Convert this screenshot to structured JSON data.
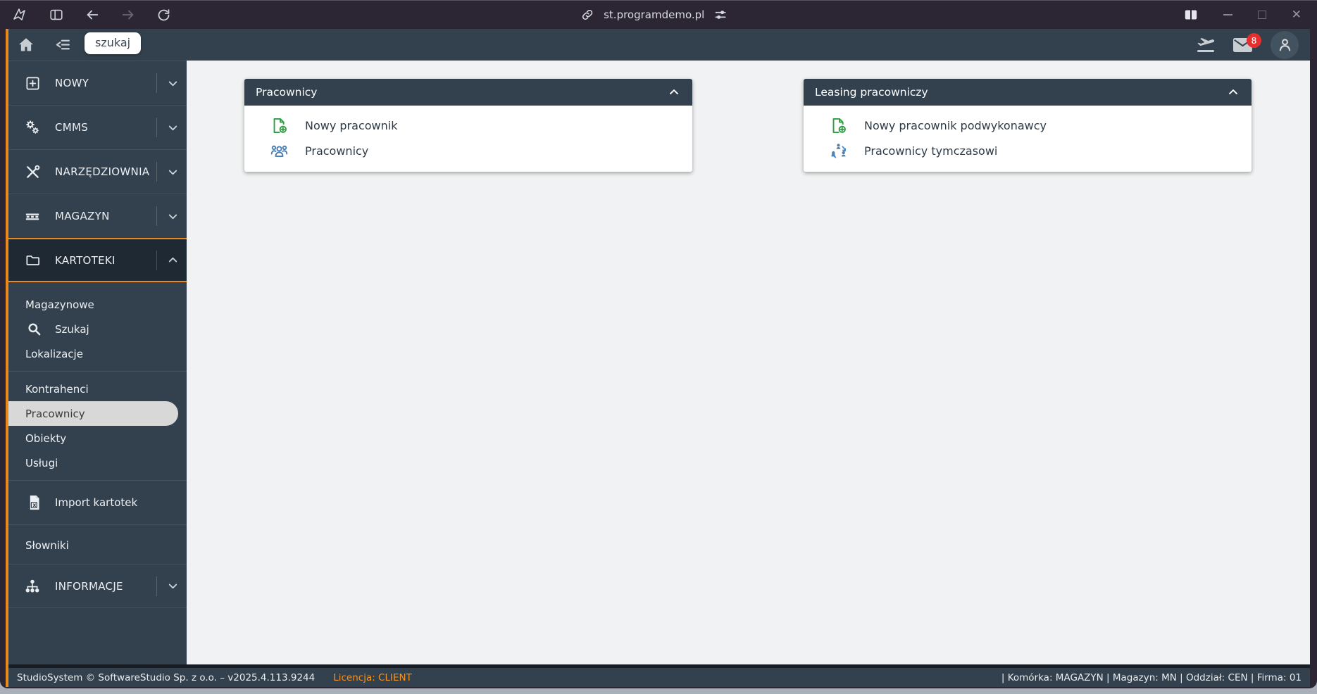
{
  "browser": {
    "url": "st.programdemo.pl"
  },
  "toolbar": {
    "tooltip": "szukaj",
    "mail_badge": "8"
  },
  "sidebar": {
    "categories": [
      {
        "label": "NOWY"
      },
      {
        "label": "CMMS"
      },
      {
        "label": "NARZĘDZIOWNIA"
      },
      {
        "label": "MAGAZYN"
      },
      {
        "label": "KARTOTEKI",
        "expanded": true
      },
      {
        "label": "INFORMACJE"
      }
    ],
    "kartoteki_items": [
      {
        "label": "Magazynowe"
      },
      {
        "label": "Szukaj",
        "icon": "search-icon"
      },
      {
        "label": "Lokalizacje"
      },
      {
        "label": "Kontrahenci"
      },
      {
        "label": "Pracownicy",
        "selected": true
      },
      {
        "label": "Obiekty"
      },
      {
        "label": "Usługi"
      },
      {
        "label": "Import kartotek",
        "icon": "file-excel-icon"
      },
      {
        "label": "Słowniki"
      }
    ]
  },
  "panels": [
    {
      "title": "Pracownicy",
      "items": [
        {
          "label": "Nowy pracownik",
          "icon": "document-add-icon"
        },
        {
          "label": "Pracownicy",
          "icon": "people-icon"
        }
      ]
    },
    {
      "title": "Leasing pracowniczy",
      "items": [
        {
          "label": "Nowy pracownik podwykonawcy",
          "icon": "document-add-icon"
        },
        {
          "label": "Pracownicy tymczasowi",
          "icon": "people-rotate-icon"
        }
      ]
    }
  ],
  "statusbar": {
    "left": "StudioSystem © SoftwareStudio Sp. z o.o. – v2025.4.113.9244",
    "license": "Licencja: CLIENT",
    "right": "| Komórka: MAGAZYN | Magazyn: MN | Oddział: CEN | Firma: 01"
  },
  "colors": {
    "accent_orange": "#e8891d",
    "badge_red": "#e62e2e",
    "icon_green": "#2f9e41",
    "icon_blue": "#4b7fb3",
    "slate": "#33414e",
    "browser_frame": "#2b2534"
  }
}
